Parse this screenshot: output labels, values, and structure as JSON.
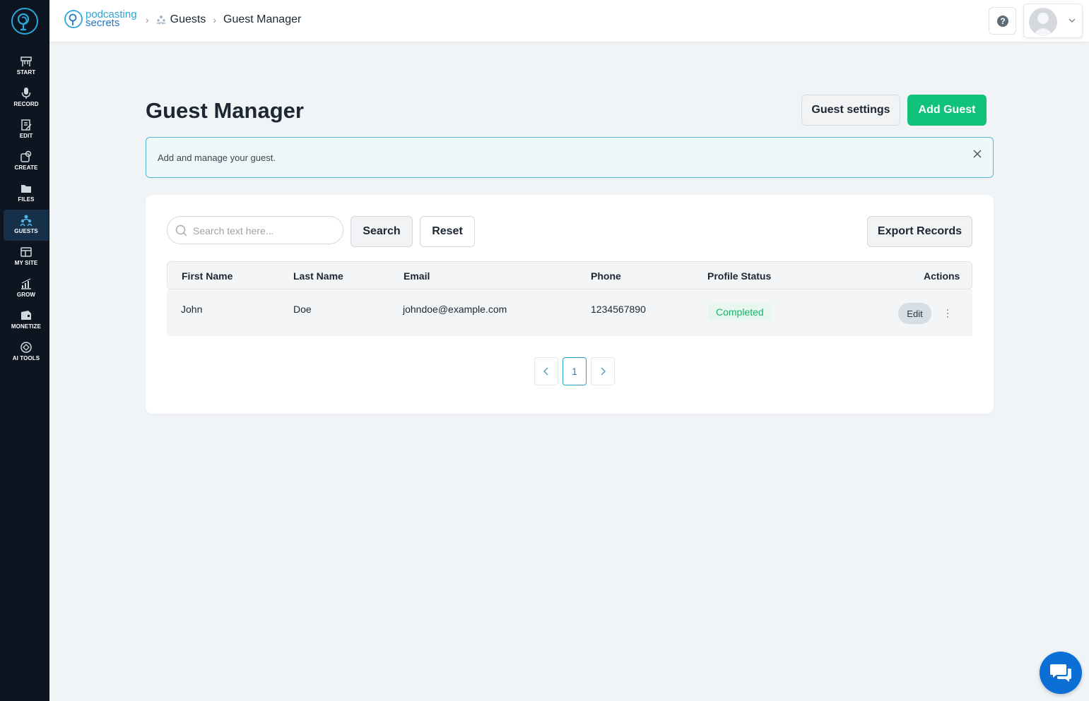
{
  "brand": {
    "line1": "podcasting",
    "line2": "secrets"
  },
  "breadcrumb": {
    "guests": "Guests",
    "current": "Guest Manager"
  },
  "sidebar": {
    "items": [
      {
        "label": "START",
        "icon": "start-icon"
      },
      {
        "label": "RECORD",
        "icon": "microphone-icon"
      },
      {
        "label": "EDIT",
        "icon": "edit-icon"
      },
      {
        "label": "CREATE",
        "icon": "create-icon"
      },
      {
        "label": "FILES",
        "icon": "files-icon"
      },
      {
        "label": "GUESTS",
        "icon": "guests-icon",
        "active": true
      },
      {
        "label": "MY SITE",
        "icon": "site-icon"
      },
      {
        "label": "GROW",
        "icon": "grow-icon"
      },
      {
        "label": "MONETIZE",
        "icon": "monetize-icon"
      },
      {
        "label": "AI TOOLS",
        "icon": "ai-tools-icon"
      }
    ]
  },
  "header": {
    "title": "Guest Manager"
  },
  "actions": {
    "settings_label": "Guest settings",
    "add_label": "Add Guest"
  },
  "notice": {
    "text": "Add and manage your guest."
  },
  "toolbar": {
    "search_placeholder": "Search text here...",
    "search_label": "Search",
    "reset_label": "Reset",
    "export_label": "Export Records"
  },
  "table": {
    "columns": [
      "First Name",
      "Last Name",
      "Email",
      "Phone",
      "Profile Status",
      "Actions"
    ],
    "rows": [
      {
        "first_name": "John",
        "last_name": "Doe",
        "email": "johndoe@example.com",
        "phone": "1234567890",
        "status": "Completed",
        "edit_label": "Edit"
      }
    ]
  },
  "pagination": {
    "current_page": "1"
  },
  "colors": {
    "accent": "#10c27a",
    "sidebar": "#0c1520",
    "status_green": "#19b26b",
    "info_border": "#54b8d4",
    "chat": "#0b6fd6"
  }
}
